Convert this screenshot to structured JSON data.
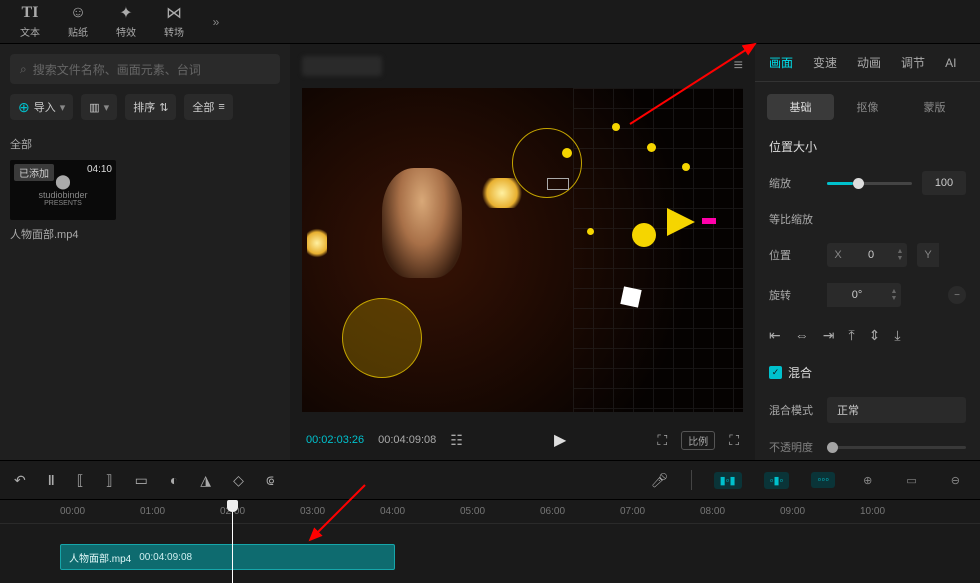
{
  "top_tabs": {
    "items": [
      {
        "icon": "TI",
        "label": "文本"
      },
      {
        "icon": "☺",
        "label": "贴纸"
      },
      {
        "icon": "✦",
        "label": "特效"
      },
      {
        "icon": "⋈",
        "label": "转场"
      }
    ],
    "expand": "»"
  },
  "left": {
    "search_placeholder": "搜索文件名称、画面元素、台词",
    "import_label": "导入",
    "view_toggle": "▥",
    "sort_label": "排序",
    "all_label": "全部",
    "section_all": "全部",
    "thumb": {
      "added_badge": "已添加",
      "duration": "04:10",
      "logo_top": "studiobinder",
      "logo_bottom": "PRESENTS",
      "filename": "人物面部.mp4"
    }
  },
  "preview": {
    "current_time": "00:02:03:26",
    "total_time": "00:04:09:08",
    "ratio": "比例",
    "hamburger": "≡"
  },
  "right": {
    "tabs": [
      "画面",
      "变速",
      "动画",
      "调节",
      "AI"
    ],
    "subtabs": [
      "基础",
      "抠像",
      "蒙版"
    ],
    "section_pos_size": "位置大小",
    "scale_label": "缩放",
    "scale_value": "100",
    "ratio_scale_label": "等比缩放",
    "position_label": "位置",
    "position_x_label": "X",
    "position_x_value": "0",
    "position_y_label": "Y",
    "rotate_label": "旋转",
    "rotate_value": "0°",
    "mix_label": "混合",
    "mix_mode_label": "混合模式",
    "mix_mode_value": "正常",
    "opacity_label": "不透明度"
  },
  "timeline": {
    "ticks": [
      "00:00",
      "01:00",
      "02:00",
      "03:00",
      "04:00",
      "05:00",
      "06:00",
      "07:00",
      "08:00",
      "09:00",
      "10:00"
    ],
    "clip_name": "人物面部.mp4",
    "clip_duration": "00:04:09:08"
  }
}
